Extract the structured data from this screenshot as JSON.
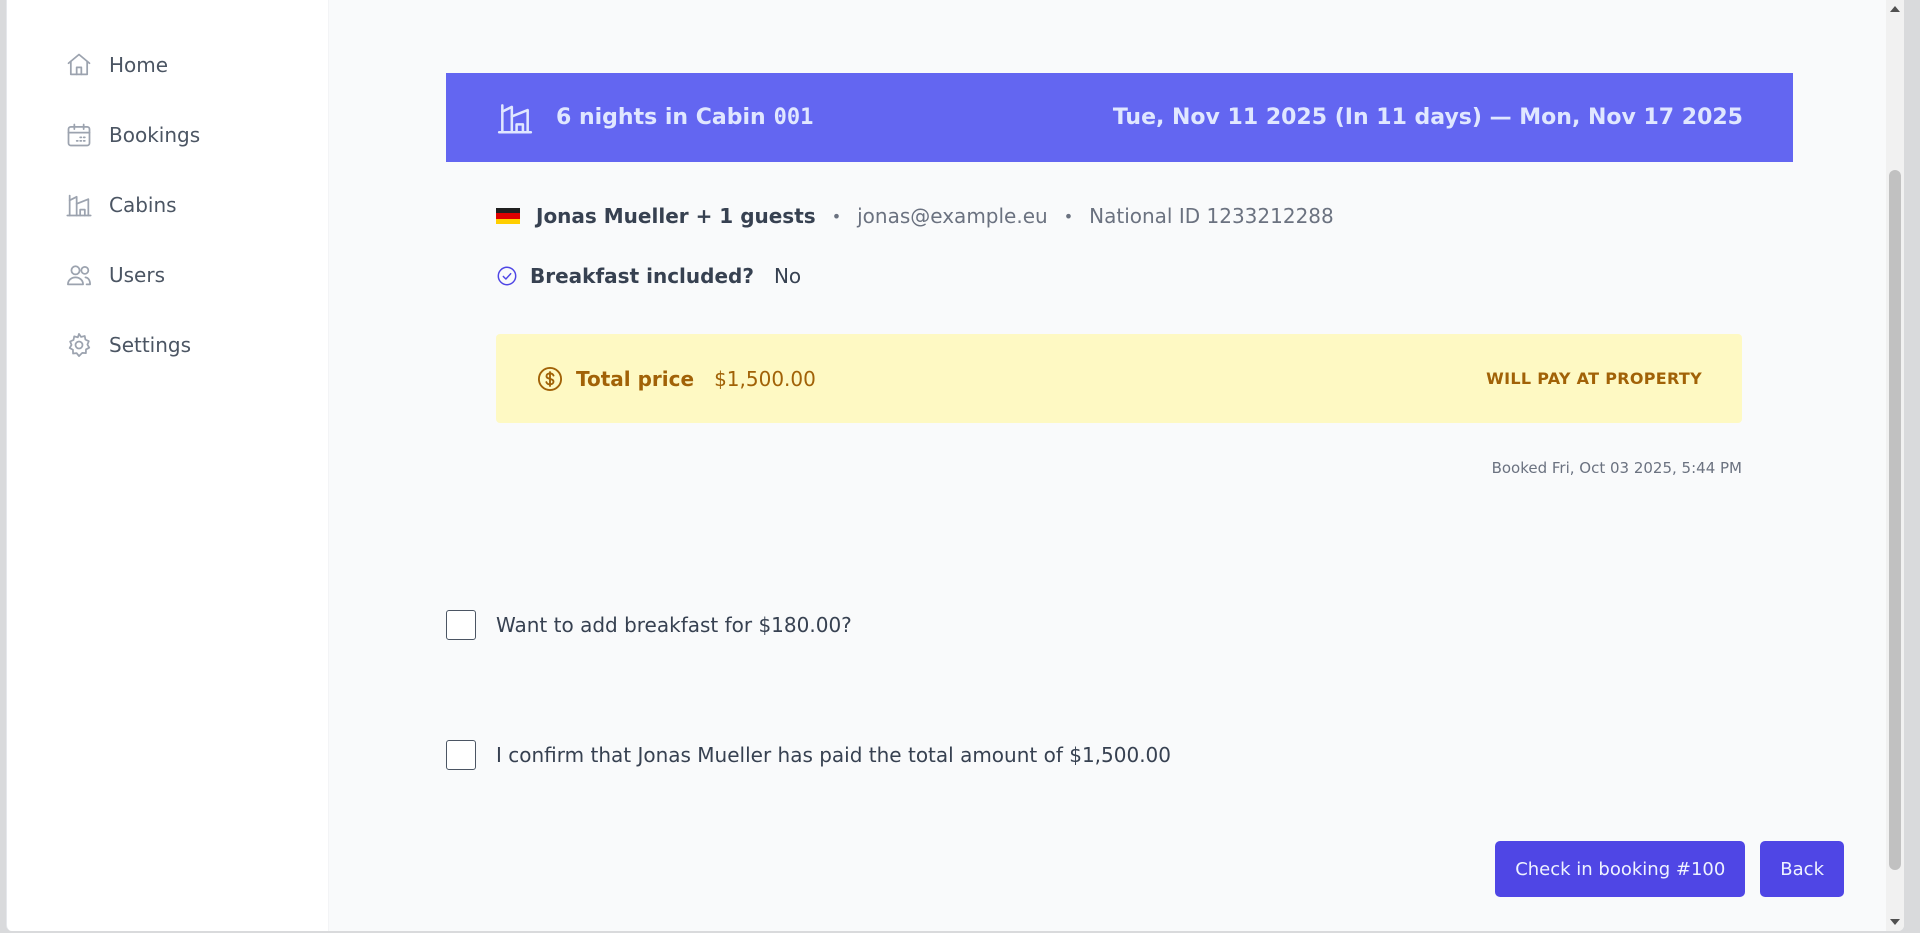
{
  "sidebar": {
    "items": [
      {
        "label": "Home",
        "icon": "home-icon"
      },
      {
        "label": "Bookings",
        "icon": "calendar-icon"
      },
      {
        "label": "Cabins",
        "icon": "cabin-icon"
      },
      {
        "label": "Users",
        "icon": "users-icon"
      },
      {
        "label": "Settings",
        "icon": "gear-icon"
      }
    ]
  },
  "booking": {
    "nights_title": "6 nights in Cabin",
    "cabin_number": "001",
    "dates": "Tue, Nov 11 2025 (In 11 days) — Mon, Nov 17 2025",
    "guest_name": "Jonas Mueller + 1 guests",
    "email": "jonas@example.eu",
    "national_id": "National ID 1233212288",
    "breakfast_label": "Breakfast included?",
    "breakfast_value": "No",
    "price_label": "Total price",
    "price_value": "$1,500.00",
    "payment_status": "WILL PAY AT PROPERTY",
    "booked_at": "Booked Fri, Oct 03 2025, 5:44 PM",
    "flag_country": "Germany"
  },
  "form": {
    "add_breakfast_label": "Want to add breakfast for $180.00?",
    "add_breakfast_checked": false,
    "confirm_paid_label": "I confirm that Jonas Mueller has paid the total amount of $1,500.00",
    "confirm_paid_checked": false
  },
  "actions": {
    "checkin_label": "Check in booking #100",
    "back_label": "Back"
  },
  "colors": {
    "accent": "#4f46e5",
    "header_bg": "#6366f1",
    "price_bg": "#fef9c3",
    "price_text": "#a16207"
  }
}
